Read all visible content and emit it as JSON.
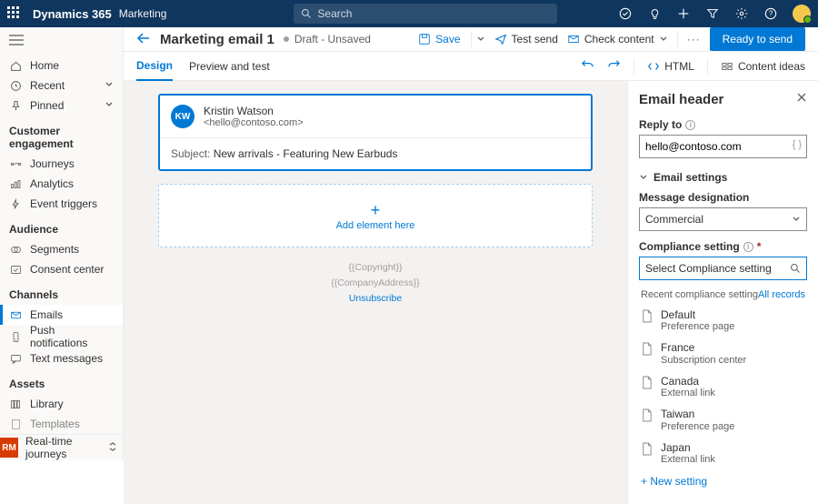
{
  "topbar": {
    "brand": "Dynamics 365",
    "brand_sub": "Marketing",
    "search_placeholder": "Search"
  },
  "sidebar": {
    "home": "Home",
    "recent": "Recent",
    "pinned": "Pinned",
    "sections": {
      "engagement": "Customer engagement",
      "audience": "Audience",
      "channels": "Channels",
      "assets": "Assets"
    },
    "items": {
      "journeys": "Journeys",
      "analytics": "Analytics",
      "event_triggers": "Event triggers",
      "segments": "Segments",
      "consent_center": "Consent center",
      "emails": "Emails",
      "push": "Push notifications",
      "text": "Text messages",
      "library": "Library",
      "templates": "Templates"
    },
    "switch_badge": "RM",
    "switch_label": "Real-time journeys"
  },
  "cmdbar": {
    "title": "Marketing email 1",
    "status": "Draft - Unsaved",
    "save": "Save",
    "test_send": "Test send",
    "check_content": "Check content",
    "ready": "Ready to send"
  },
  "tabs": {
    "design": "Design",
    "preview": "Preview and test",
    "html": "HTML",
    "content_ideas": "Content ideas"
  },
  "email": {
    "from_initials": "KW",
    "from_name": "Kristin Watson",
    "from_email": "<hello@contoso.com>",
    "subject_label": "Subject:",
    "subject_value": "New arrivals - Featuring New Earbuds",
    "add_element": "Add element here",
    "footer_copyright": "{{Copyright}}",
    "footer_address": "{{CompanyAddress}}",
    "footer_unsub": "Unsubscribe"
  },
  "panel": {
    "title": "Email header",
    "reply_to_label": "Reply to",
    "reply_to_value": "hello@contoso.com",
    "email_settings": "Email settings",
    "designation_label": "Message designation",
    "designation_value": "Commercial",
    "compliance_label": "Compliance setting",
    "compliance_placeholder": "Select Compliance setting",
    "recent_label": "Recent compliance setting",
    "all_records": "All records",
    "options": [
      {
        "name": "Default",
        "sub": "Preference page"
      },
      {
        "name": "France",
        "sub": "Subscription center"
      },
      {
        "name": "Canada",
        "sub": "External link"
      },
      {
        "name": "Taiwan",
        "sub": "Preference page"
      },
      {
        "name": "Japan",
        "sub": "External link"
      }
    ],
    "new_setting": "+ New setting"
  }
}
